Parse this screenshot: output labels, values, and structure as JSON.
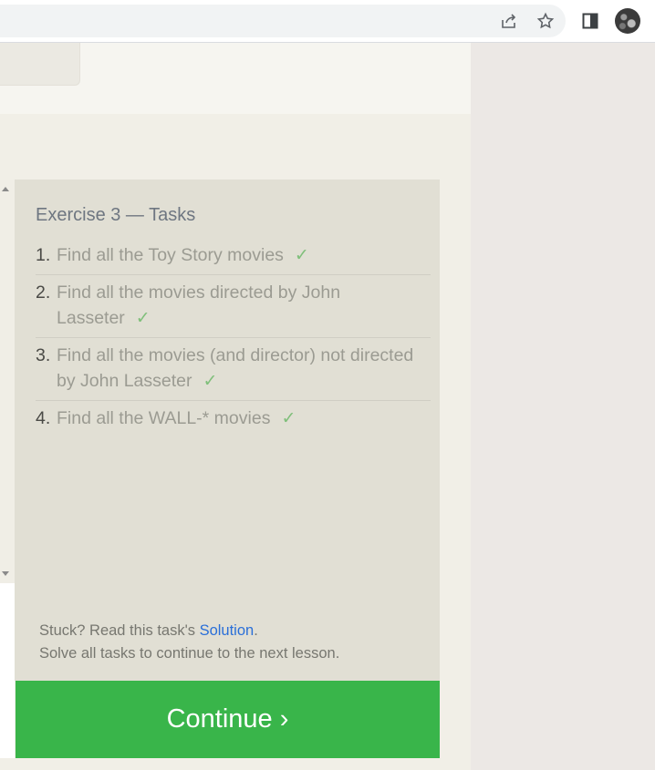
{
  "browser": {
    "icons": [
      "share-icon",
      "star-icon",
      "side-panel-icon",
      "profile-avatar"
    ]
  },
  "tasks_panel": {
    "title": "Exercise 3 — Tasks",
    "tasks": [
      {
        "num": "1.",
        "text": "Find all the Toy Story movies",
        "check": "✓"
      },
      {
        "num": "2.",
        "text": "Find all the movies directed by John Lasseter",
        "check": "✓"
      },
      {
        "num": "3.",
        "text": "Find all the movies (and director) not directed by John Lasseter",
        "check": "✓"
      },
      {
        "num": "4.",
        "text": "Find all the WALL-* movies",
        "check": "✓"
      }
    ],
    "stuck_prefix": "Stuck? Read this task's ",
    "solution_link": "Solution",
    "stuck_suffix": ".",
    "solve_all": "Solve all tasks to continue to the next lesson."
  },
  "continue_button": "Continue ›",
  "colors": {
    "accent_green": "#39b54a",
    "link_blue": "#2a6fd8",
    "check_green": "#7fbf7a"
  }
}
